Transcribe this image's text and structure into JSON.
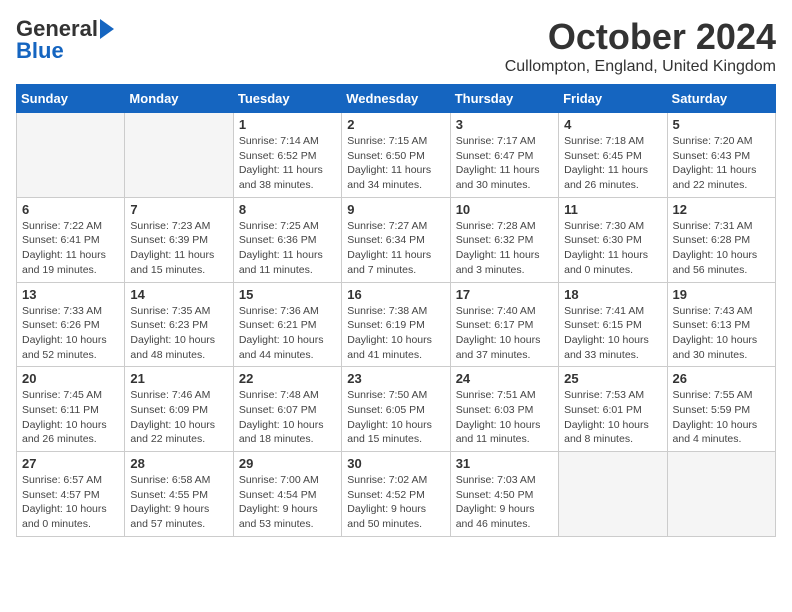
{
  "header": {
    "logo_line1": "General",
    "logo_line2": "Blue",
    "month": "October 2024",
    "location": "Cullompton, England, United Kingdom"
  },
  "days_of_week": [
    "Sunday",
    "Monday",
    "Tuesday",
    "Wednesday",
    "Thursday",
    "Friday",
    "Saturday"
  ],
  "weeks": [
    [
      {
        "day": "",
        "content": ""
      },
      {
        "day": "",
        "content": ""
      },
      {
        "day": "1",
        "content": "Sunrise: 7:14 AM\nSunset: 6:52 PM\nDaylight: 11 hours and 38 minutes."
      },
      {
        "day": "2",
        "content": "Sunrise: 7:15 AM\nSunset: 6:50 PM\nDaylight: 11 hours and 34 minutes."
      },
      {
        "day": "3",
        "content": "Sunrise: 7:17 AM\nSunset: 6:47 PM\nDaylight: 11 hours and 30 minutes."
      },
      {
        "day": "4",
        "content": "Sunrise: 7:18 AM\nSunset: 6:45 PM\nDaylight: 11 hours and 26 minutes."
      },
      {
        "day": "5",
        "content": "Sunrise: 7:20 AM\nSunset: 6:43 PM\nDaylight: 11 hours and 22 minutes."
      }
    ],
    [
      {
        "day": "6",
        "content": "Sunrise: 7:22 AM\nSunset: 6:41 PM\nDaylight: 11 hours and 19 minutes."
      },
      {
        "day": "7",
        "content": "Sunrise: 7:23 AM\nSunset: 6:39 PM\nDaylight: 11 hours and 15 minutes."
      },
      {
        "day": "8",
        "content": "Sunrise: 7:25 AM\nSunset: 6:36 PM\nDaylight: 11 hours and 11 minutes."
      },
      {
        "day": "9",
        "content": "Sunrise: 7:27 AM\nSunset: 6:34 PM\nDaylight: 11 hours and 7 minutes."
      },
      {
        "day": "10",
        "content": "Sunrise: 7:28 AM\nSunset: 6:32 PM\nDaylight: 11 hours and 3 minutes."
      },
      {
        "day": "11",
        "content": "Sunrise: 7:30 AM\nSunset: 6:30 PM\nDaylight: 11 hours and 0 minutes."
      },
      {
        "day": "12",
        "content": "Sunrise: 7:31 AM\nSunset: 6:28 PM\nDaylight: 10 hours and 56 minutes."
      }
    ],
    [
      {
        "day": "13",
        "content": "Sunrise: 7:33 AM\nSunset: 6:26 PM\nDaylight: 10 hours and 52 minutes."
      },
      {
        "day": "14",
        "content": "Sunrise: 7:35 AM\nSunset: 6:23 PM\nDaylight: 10 hours and 48 minutes."
      },
      {
        "day": "15",
        "content": "Sunrise: 7:36 AM\nSunset: 6:21 PM\nDaylight: 10 hours and 44 minutes."
      },
      {
        "day": "16",
        "content": "Sunrise: 7:38 AM\nSunset: 6:19 PM\nDaylight: 10 hours and 41 minutes."
      },
      {
        "day": "17",
        "content": "Sunrise: 7:40 AM\nSunset: 6:17 PM\nDaylight: 10 hours and 37 minutes."
      },
      {
        "day": "18",
        "content": "Sunrise: 7:41 AM\nSunset: 6:15 PM\nDaylight: 10 hours and 33 minutes."
      },
      {
        "day": "19",
        "content": "Sunrise: 7:43 AM\nSunset: 6:13 PM\nDaylight: 10 hours and 30 minutes."
      }
    ],
    [
      {
        "day": "20",
        "content": "Sunrise: 7:45 AM\nSunset: 6:11 PM\nDaylight: 10 hours and 26 minutes."
      },
      {
        "day": "21",
        "content": "Sunrise: 7:46 AM\nSunset: 6:09 PM\nDaylight: 10 hours and 22 minutes."
      },
      {
        "day": "22",
        "content": "Sunrise: 7:48 AM\nSunset: 6:07 PM\nDaylight: 10 hours and 18 minutes."
      },
      {
        "day": "23",
        "content": "Sunrise: 7:50 AM\nSunset: 6:05 PM\nDaylight: 10 hours and 15 minutes."
      },
      {
        "day": "24",
        "content": "Sunrise: 7:51 AM\nSunset: 6:03 PM\nDaylight: 10 hours and 11 minutes."
      },
      {
        "day": "25",
        "content": "Sunrise: 7:53 AM\nSunset: 6:01 PM\nDaylight: 10 hours and 8 minutes."
      },
      {
        "day": "26",
        "content": "Sunrise: 7:55 AM\nSunset: 5:59 PM\nDaylight: 10 hours and 4 minutes."
      }
    ],
    [
      {
        "day": "27",
        "content": "Sunrise: 6:57 AM\nSunset: 4:57 PM\nDaylight: 10 hours and 0 minutes."
      },
      {
        "day": "28",
        "content": "Sunrise: 6:58 AM\nSunset: 4:55 PM\nDaylight: 9 hours and 57 minutes."
      },
      {
        "day": "29",
        "content": "Sunrise: 7:00 AM\nSunset: 4:54 PM\nDaylight: 9 hours and 53 minutes."
      },
      {
        "day": "30",
        "content": "Sunrise: 7:02 AM\nSunset: 4:52 PM\nDaylight: 9 hours and 50 minutes."
      },
      {
        "day": "31",
        "content": "Sunrise: 7:03 AM\nSunset: 4:50 PM\nDaylight: 9 hours and 46 minutes."
      },
      {
        "day": "",
        "content": ""
      },
      {
        "day": "",
        "content": ""
      }
    ]
  ]
}
